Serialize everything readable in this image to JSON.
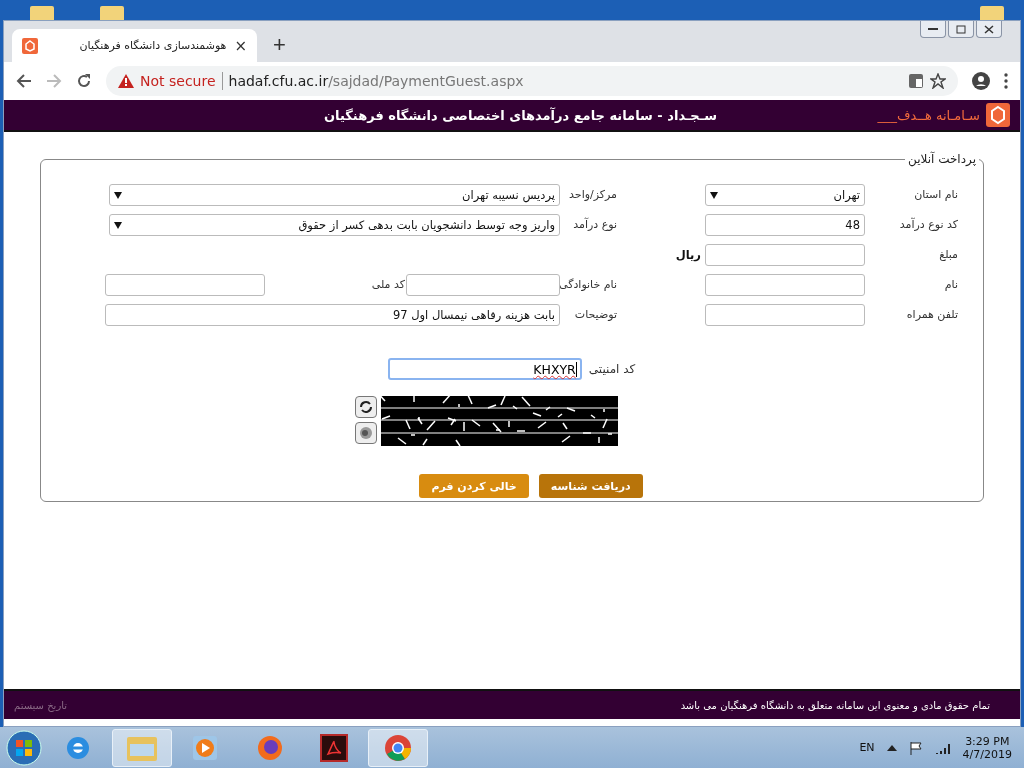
{
  "browser": {
    "tab": {
      "title": "هوشمندسازی دانشگاه فرهنگیان",
      "close": "×",
      "selected": true
    },
    "new_tab": "+",
    "security": "Not secure",
    "url_host": "hadaf.cfu.ac.ir",
    "url_path": "/sajdad/PaymentGuest.aspx"
  },
  "header": {
    "logo_text": "سـامـانه هــدف___",
    "title": "سـجـداد - سامانه جامع درآمدهای اختصاصی دانشگاه فرهنگیان"
  },
  "form": {
    "title": "پرداخت آنلاین",
    "rows": [
      [
        {
          "kind": "select",
          "label": "نام استان",
          "value": "تهران",
          "wide": false
        },
        {
          "kind": "select",
          "label": "مرکز/واحد",
          "value": "پردیس نسیبه تهران",
          "wide": true
        }
      ],
      [
        {
          "kind": "text",
          "label": "کد نوع درآمد",
          "value": "48",
          "wide": false
        },
        {
          "kind": "select",
          "label": "نوع درآمد",
          "value": "واریز وجه توسط دانشجویان بابت بدهی کسر از حقوق",
          "wide": true
        }
      ],
      [
        {
          "kind": "text",
          "label": "مبلغ",
          "unit": "ریال",
          "wide": false
        }
      ],
      [
        {
          "kind": "text",
          "label": "نام",
          "wide": false
        },
        {
          "kind": "text",
          "label": "نام خانوادگی",
          "wide": false
        },
        {
          "kind": "text",
          "label": "کد ملی"
        }
      ],
      [
        {
          "kind": "text",
          "label": "تلفن همراه",
          "wide": false
        },
        {
          "kind": "text",
          "label": "توضیحات",
          "value": "بابت هزینه رفاهی نیمسال اول 97",
          "wide": true
        }
      ]
    ],
    "captcha": {
      "label": "کد امنیتی",
      "value": "KHXYR",
      "focused": true
    },
    "buttons": [
      {
        "label": "دریافت شناسه",
        "kind": "primary"
      },
      {
        "label": "خالی کردن فرم",
        "kind": "secondary"
      }
    ]
  },
  "footer": {
    "copyright": "تمام حقوق مادی و معنوی این سامانه متعلق به دانشگاه فرهنگیان می باشد",
    "system_date": "تاریخ سیستم"
  },
  "taskbar": {
    "apps": [
      {
        "kind": "ie",
        "selected": false
      },
      {
        "kind": "explorer",
        "selected": true
      },
      {
        "kind": "media",
        "selected": false
      },
      {
        "kind": "firefox",
        "selected": false
      },
      {
        "kind": "acrobat",
        "selected": false
      },
      {
        "kind": "chrome",
        "selected": true
      }
    ],
    "language": "EN",
    "time": "3:29 PM",
    "date": "4/7/2019"
  }
}
